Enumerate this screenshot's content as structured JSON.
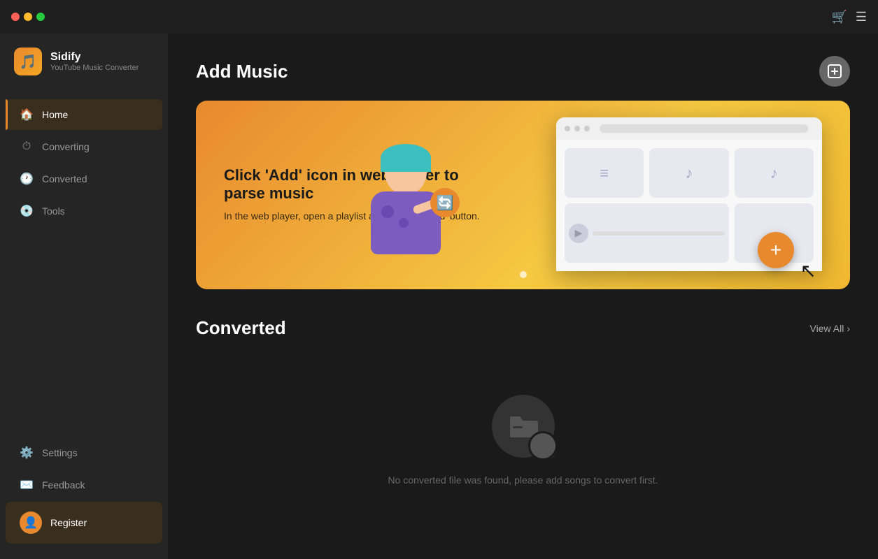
{
  "app": {
    "name": "Sidify",
    "subtitle": "YouTube Music Converter",
    "logo_icon": "🎵"
  },
  "title_bar": {
    "cart_icon": "🛒",
    "menu_icon": "☰"
  },
  "sidebar": {
    "items": [
      {
        "id": "home",
        "label": "Home",
        "icon": "🏠",
        "active": true
      },
      {
        "id": "converting",
        "label": "Converting",
        "icon": "⏱",
        "active": false
      },
      {
        "id": "converted",
        "label": "Converted",
        "icon": "🕐",
        "active": false
      },
      {
        "id": "tools",
        "label": "Tools",
        "icon": "💿",
        "active": false
      }
    ],
    "bottom_items": [
      {
        "id": "settings",
        "label": "Settings",
        "icon": "⚙️"
      },
      {
        "id": "feedback",
        "label": "Feedback",
        "icon": "✉️"
      }
    ],
    "register": {
      "label": "Register",
      "icon": "👤"
    }
  },
  "main": {
    "add_music": {
      "title": "Add Music",
      "action_icon": "⊞"
    },
    "banner": {
      "title": "Click 'Add' icon in web player to parse music",
      "subtitle": "In the web player, open a playlist and click the 'Add' button.",
      "plus_label": "+"
    },
    "converted": {
      "title": "Converted",
      "view_all_label": "View All",
      "empty_text": "No converted file was found, please add songs to convert first."
    }
  }
}
